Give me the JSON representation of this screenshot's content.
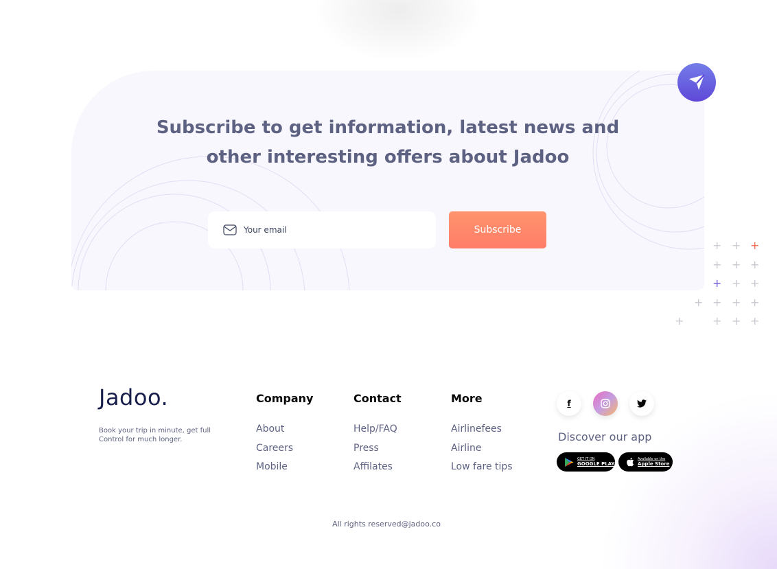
{
  "subscribe": {
    "title": "Subscribe to get information, latest news and other interesting offers about Jadoo",
    "email_placeholder": "Your email",
    "button_label": "Subscribe"
  },
  "footer": {
    "logo": "Jadoo.",
    "tagline": "Book your trip in minute, get full Control for much longer.",
    "columns": [
      {
        "heading": "Company",
        "links": [
          "About",
          "Careers",
          "Mobile"
        ]
      },
      {
        "heading": "Contact",
        "links": [
          "Help/FAQ",
          "Press",
          "Affilates"
        ]
      },
      {
        "heading": "More",
        "links": [
          "Airlinefees",
          "Airline",
          "Low fare tips"
        ]
      }
    ],
    "social": [
      {
        "name": "facebook",
        "glyph": "f"
      },
      {
        "name": "instagram",
        "glyph": ""
      },
      {
        "name": "twitter",
        "glyph": ""
      }
    ],
    "discover_label": "Discover our app",
    "stores": {
      "google": {
        "small": "GET IT ON",
        "big": "GOOGLE PLAY"
      },
      "apple": {
        "small": "Available on the",
        "big": "Apple Store"
      }
    },
    "copyright": "All rights reserved@jadoo.co"
  },
  "colors": {
    "accent_orange": "#ff7d68",
    "accent_purple": "#5f48d8",
    "plus_red": "#f16a4d",
    "plus_purple": "#6c59dc",
    "text_dark": "#181e4b",
    "text_muted": "#5e6282"
  }
}
